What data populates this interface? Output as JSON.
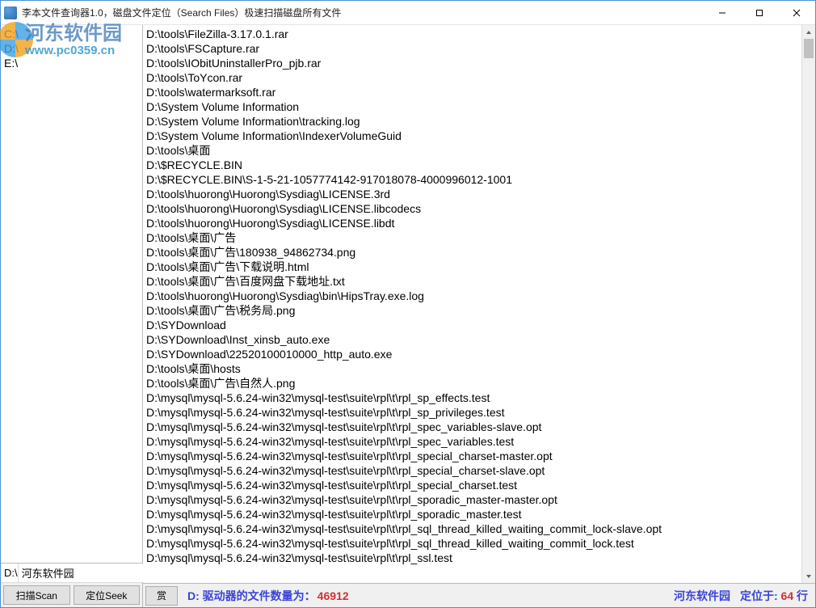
{
  "window": {
    "title": "李本文件查询器1.0，磁盘文件定位（Search Files）极速扫描磁盘所有文件"
  },
  "watermark": {
    "line1": "河东软件园",
    "line2": "www.pc0359.cn"
  },
  "drives": [
    "C:\\",
    "D:\\",
    "E:\\"
  ],
  "left": {
    "drive_label": "D:\\",
    "search_value": "河东软件园",
    "scan_btn": "扫描Scan",
    "seek_btn": "定位Seek"
  },
  "files": [
    "D:\\tools\\FileZilla-3.17.0.1.rar",
    "D:\\tools\\FSCapture.rar",
    "D:\\tools\\IObitUninstallerPro_pjb.rar",
    "D:\\tools\\ToYcon.rar",
    "D:\\tools\\watermarksoft.rar",
    "D:\\System Volume Information",
    "D:\\System Volume Information\\tracking.log",
    "D:\\System Volume Information\\IndexerVolumeGuid",
    "D:\\tools\\桌面",
    "D:\\$RECYCLE.BIN",
    "D:\\$RECYCLE.BIN\\S-1-5-21-1057774142-917018078-4000996012-1001",
    "D:\\tools\\huorong\\Huorong\\Sysdiag\\LICENSE.3rd",
    "D:\\tools\\huorong\\Huorong\\Sysdiag\\LICENSE.libcodecs",
    "D:\\tools\\huorong\\Huorong\\Sysdiag\\LICENSE.libdt",
    "D:\\tools\\桌面\\广告",
    "D:\\tools\\桌面\\广告\\180938_94862734.png",
    "D:\\tools\\桌面\\广告\\下载说明.html",
    "D:\\tools\\桌面\\广告\\百度网盘下载地址.txt",
    "D:\\tools\\huorong\\Huorong\\Sysdiag\\bin\\HipsTray.exe.log",
    "D:\\tools\\桌面\\广告\\税务局.png",
    "D:\\SYDownload",
    "D:\\SYDownload\\Inst_xinsb_auto.exe",
    "D:\\SYDownload\\22520100010000_http_auto.exe",
    "D:\\tools\\桌面\\hosts",
    "D:\\tools\\桌面\\广告\\自然人.png",
    "D:\\mysql\\mysql-5.6.24-win32\\mysql-test\\suite\\rpl\\t\\rpl_sp_effects.test",
    "D:\\mysql\\mysql-5.6.24-win32\\mysql-test\\suite\\rpl\\t\\rpl_sp_privileges.test",
    "D:\\mysql\\mysql-5.6.24-win32\\mysql-test\\suite\\rpl\\t\\rpl_spec_variables-slave.opt",
    "D:\\mysql\\mysql-5.6.24-win32\\mysql-test\\suite\\rpl\\t\\rpl_spec_variables.test",
    "D:\\mysql\\mysql-5.6.24-win32\\mysql-test\\suite\\rpl\\t\\rpl_special_charset-master.opt",
    "D:\\mysql\\mysql-5.6.24-win32\\mysql-test\\suite\\rpl\\t\\rpl_special_charset-slave.opt",
    "D:\\mysql\\mysql-5.6.24-win32\\mysql-test\\suite\\rpl\\t\\rpl_special_charset.test",
    "D:\\mysql\\mysql-5.6.24-win32\\mysql-test\\suite\\rpl\\t\\rpl_sporadic_master-master.opt",
    "D:\\mysql\\mysql-5.6.24-win32\\mysql-test\\suite\\rpl\\t\\rpl_sporadic_master.test",
    "D:\\mysql\\mysql-5.6.24-win32\\mysql-test\\suite\\rpl\\t\\rpl_sql_thread_killed_waiting_commit_lock-slave.opt",
    "D:\\mysql\\mysql-5.6.24-win32\\mysql-test\\suite\\rpl\\t\\rpl_sql_thread_killed_waiting_commit_lock.test",
    "D:\\mysql\\mysql-5.6.24-win32\\mysql-test\\suite\\rpl\\t\\rpl_ssl.test"
  ],
  "bottom": {
    "reward_btn": "赏",
    "status_prefix": "D: 驱动器的文件数量为：",
    "status_count": "46912",
    "brand": "河东软件园",
    "locate_prefix": "定位于:",
    "locate_num": "64",
    "locate_suffix": "行"
  }
}
